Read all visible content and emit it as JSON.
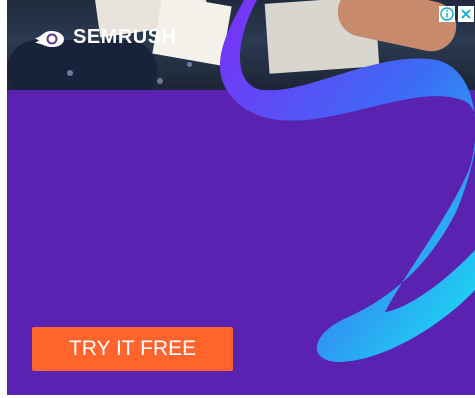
{
  "brand": {
    "name": "SEMRUSH",
    "logo_icon": "semrush-fire-icon"
  },
  "cta": {
    "label": "TRY IT FREE"
  },
  "adchoices": {
    "info_icon": "info-icon",
    "close_icon": "close-icon"
  },
  "colors": {
    "background": "#5a22b0",
    "cta": "#ff642d",
    "swoosh_start": "#7b2ff7",
    "swoosh_end": "#19e6f0"
  }
}
